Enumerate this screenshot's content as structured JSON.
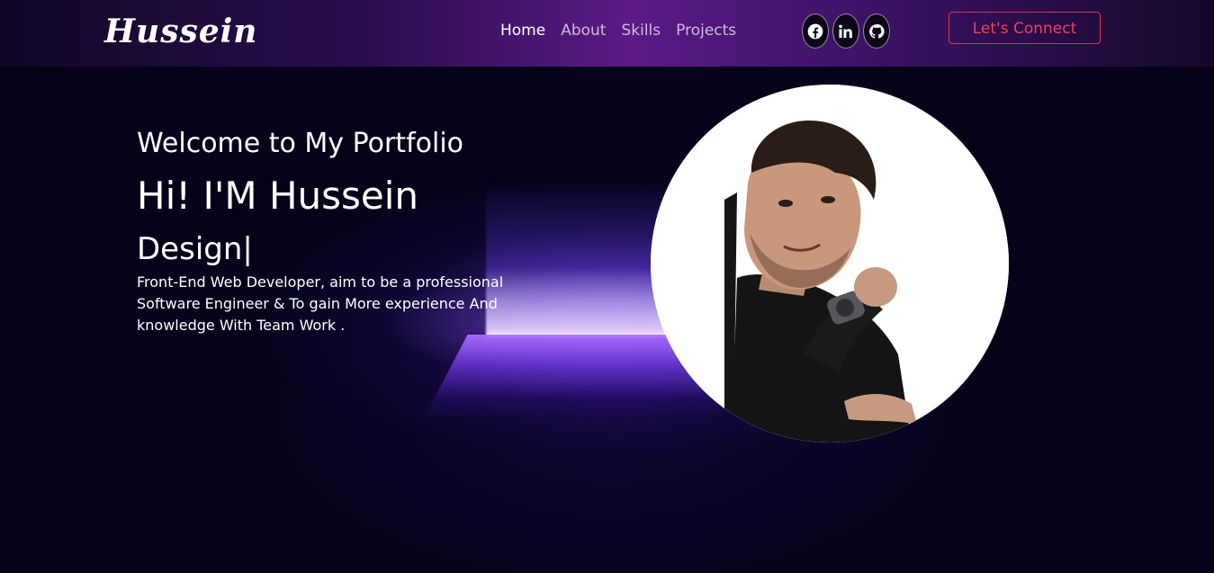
{
  "header": {
    "logo": "Hussein",
    "nav": [
      {
        "label": "Home",
        "active": true
      },
      {
        "label": "About",
        "active": false
      },
      {
        "label": "Skills",
        "active": false
      },
      {
        "label": "Projects",
        "active": false
      }
    ],
    "socials": [
      {
        "icon": "facebook-icon"
      },
      {
        "icon": "linkedin-icon"
      },
      {
        "icon": "github-icon"
      }
    ],
    "connect_label": "Let's Connect"
  },
  "hero": {
    "welcome": "Welcome to My Portfolio",
    "name": "Hi! I'M Hussein",
    "typed": "Design|",
    "description": "Front-End Web Developer, aim to be a professional Software Engineer & To gain More experience And knowledge With Team Work ."
  },
  "colors": {
    "accent": "#e0334f",
    "background": "#05031a",
    "nav_gradient_center": "#5b1a86"
  }
}
